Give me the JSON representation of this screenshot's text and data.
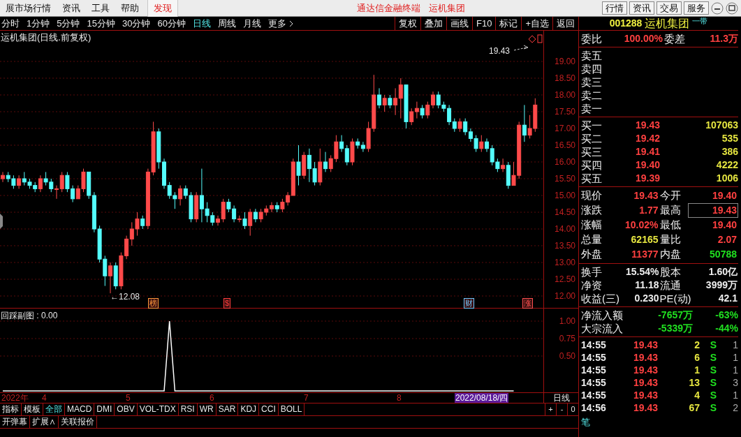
{
  "menu": [
    {
      "label": "展市场行情",
      "selected": false
    },
    {
      "label": "资讯",
      "selected": false
    },
    {
      "label": "工具",
      "selected": false
    },
    {
      "label": "帮助",
      "selected": false
    },
    {
      "label": "发现",
      "selected": true
    }
  ],
  "app_title": [
    "通达信金融终端",
    "运机集团"
  ],
  "top_buttons": [
    "行情",
    "资讯",
    "交易",
    "服务"
  ],
  "periods": [
    {
      "label": "分时",
      "selected": false
    },
    {
      "label": "1分钟",
      "selected": false
    },
    {
      "label": "5分钟",
      "selected": false
    },
    {
      "label": "15分钟",
      "selected": false
    },
    {
      "label": "30分钟",
      "selected": false
    },
    {
      "label": "60分钟",
      "selected": false
    },
    {
      "label": "日线",
      "selected": true
    },
    {
      "label": "周线",
      "selected": false
    },
    {
      "label": "月线",
      "selected": false
    },
    {
      "label": "更多",
      "selected": false
    }
  ],
  "chart_tools": [
    "复权",
    "叠加",
    "画线",
    "F10",
    "标记",
    "+自选",
    "返回"
  ],
  "chart_title": "运机集团(日线.前复权)",
  "chart_data": {
    "type": "candlestick",
    "grid": true,
    "ylim": [
      11.625,
      19.917
    ],
    "yticks": [
      {
        "value": 19,
        "label": "19.00"
      },
      {
        "value": 18.5,
        "label": "18.50"
      },
      {
        "value": 18,
        "label": "18.00"
      },
      {
        "value": 17.5,
        "label": "17.50"
      },
      {
        "value": 17,
        "label": "17.00"
      },
      {
        "value": 16.5,
        "label": "16.50"
      },
      {
        "value": 16,
        "label": "16.00"
      },
      {
        "value": 15.5,
        "label": "15.50"
      },
      {
        "value": 15,
        "label": "15.00"
      },
      {
        "value": 14.5,
        "label": "14.50"
      },
      {
        "value": 14,
        "label": "14.00"
      },
      {
        "value": 13.5,
        "label": "13.50"
      },
      {
        "value": 13,
        "label": "13.00"
      },
      {
        "value": 12.5,
        "label": "12.50"
      },
      {
        "value": 12,
        "label": "12.00"
      }
    ],
    "categories": [
      null,
      null,
      null,
      null,
      null,
      null,
      null,
      null,
      null,
      null,
      null,
      null,
      null,
      null,
      null,
      null,
      null,
      null,
      null,
      null,
      null,
      null,
      null,
      null,
      null,
      null,
      null,
      null,
      null,
      null,
      null,
      null,
      null,
      null,
      null,
      null,
      null,
      null,
      null,
      null,
      null,
      null,
      null,
      null,
      null,
      null,
      null,
      null,
      null,
      null,
      null,
      null,
      null,
      null,
      null,
      null,
      null,
      null,
      null,
      null,
      null,
      null,
      null,
      null,
      null,
      null,
      null,
      null,
      null,
      null,
      null,
      null,
      null,
      null,
      null,
      null,
      null,
      null,
      null,
      null,
      null,
      null,
      null,
      null,
      null,
      null,
      null,
      null,
      null,
      null,
      null,
      null,
      null,
      null,
      null,
      null,
      null,
      null,
      null,
      null
    ],
    "ohlc": [
      [
        15.5,
        15.7,
        15.4,
        15.6
      ],
      [
        15.6,
        15.7,
        15.4,
        15.5
      ],
      [
        15.5,
        15.6,
        15.2,
        15.3
      ],
      [
        15.3,
        15.6,
        15.2,
        15.5
      ],
      [
        15.5,
        15.7,
        15.3,
        15.4
      ],
      [
        15.4,
        15.5,
        15.2,
        15.3
      ],
      [
        15.3,
        15.4,
        15.1,
        15.2
      ],
      [
        15.2,
        15.6,
        15.1,
        15.5
      ],
      [
        15.5,
        15.7,
        15.3,
        15.4
      ],
      [
        15.4,
        15.5,
        15.1,
        15.2
      ],
      [
        15.2,
        15.3,
        14.9,
        15.2
      ],
      [
        15.2,
        15.7,
        15.1,
        15.6
      ],
      [
        15.6,
        15.7,
        15.1,
        15.2
      ],
      [
        15.2,
        15.3,
        14.8,
        14.9
      ],
      [
        14.9,
        15.3,
        14.9,
        15.2
      ],
      [
        15.2,
        15.8,
        15.1,
        15.7
      ],
      [
        15.7,
        15.7,
        14.9,
        15.0
      ],
      [
        15.0,
        15.1,
        13.9,
        14.0
      ],
      [
        14.0,
        14.1,
        13.0,
        13.1
      ],
      [
        13.1,
        13.2,
        12.3,
        12.6
      ],
      [
        12.6,
        13.0,
        12.08,
        12.9
      ],
      [
        12.9,
        13.0,
        12.2,
        12.3
      ],
      [
        12.3,
        13.3,
        12.2,
        13.2
      ],
      [
        13.2,
        13.8,
        13.1,
        13.7
      ],
      [
        13.7,
        14.2,
        13.5,
        14.0
      ],
      [
        14.0,
        14.5,
        13.8,
        14.3
      ],
      [
        14.3,
        14.4,
        14.0,
        14.1
      ],
      [
        14.1,
        15.8,
        14.0,
        15.7
      ],
      [
        15.7,
        17.2,
        15.6,
        16.9
      ],
      [
        16.9,
        17.0,
        15.8,
        16.0
      ],
      [
        16.0,
        16.1,
        15.2,
        15.3
      ],
      [
        15.3,
        15.4,
        14.9,
        15.0
      ],
      [
        15.0,
        15.1,
        14.6,
        14.9
      ],
      [
        14.9,
        15.3,
        14.7,
        15.2
      ],
      [
        15.2,
        15.3,
        14.9,
        15.0
      ],
      [
        15.0,
        15.1,
        14.2,
        14.3
      ],
      [
        14.3,
        15.1,
        14.2,
        15.0
      ],
      [
        15.0,
        15.8,
        14.2,
        14.6
      ],
      [
        14.6,
        14.8,
        14.2,
        14.4
      ],
      [
        14.4,
        14.5,
        14.1,
        14.2
      ],
      [
        14.2,
        14.4,
        14.1,
        14.3
      ],
      [
        14.3,
        14.9,
        14.2,
        14.8
      ],
      [
        14.8,
        14.9,
        14.5,
        14.6
      ],
      [
        14.6,
        14.7,
        14.2,
        14.3
      ],
      [
        14.3,
        14.4,
        14.2,
        14.3
      ],
      [
        14.3,
        14.5,
        14.0,
        14.1
      ],
      [
        14.1,
        14.6,
        13.8,
        14.5
      ],
      [
        14.5,
        14.6,
        14.2,
        14.3
      ],
      [
        14.3,
        14.6,
        14.2,
        14.5
      ],
      [
        14.5,
        14.7,
        14.4,
        14.6
      ],
      [
        14.6,
        14.8,
        14.5,
        14.7
      ],
      [
        14.7,
        14.8,
        14.5,
        14.6
      ],
      [
        14.6,
        14.9,
        14.5,
        14.8
      ],
      [
        14.8,
        15.1,
        14.7,
        15.0
      ],
      [
        15.0,
        16.1,
        15.0,
        16.0
      ],
      [
        16.0,
        16.5,
        15.3,
        15.6
      ],
      [
        15.6,
        16.3,
        15.5,
        16.2
      ],
      [
        16.2,
        16.4,
        15.4,
        15.8
      ],
      [
        15.8,
        16.0,
        15.3,
        15.4
      ],
      [
        15.4,
        16.4,
        15.3,
        16.0
      ],
      [
        16.0,
        16.3,
        15.7,
        15.8
      ],
      [
        15.8,
        16.2,
        15.7,
        16.1
      ],
      [
        16.1,
        16.8,
        16.0,
        16.6
      ],
      [
        16.6,
        16.8,
        16.3,
        16.4
      ],
      [
        16.4,
        16.5,
        15.9,
        16.0
      ],
      [
        16.0,
        16.7,
        15.9,
        16.6
      ],
      [
        16.6,
        16.7,
        16.4,
        16.5
      ],
      [
        16.5,
        16.6,
        16.3,
        16.4
      ],
      [
        16.4,
        17.2,
        16.3,
        17.0
      ],
      [
        17.0,
        18.6,
        16.9,
        18.0
      ],
      [
        18.0,
        18.2,
        17.6,
        17.7
      ],
      [
        17.7,
        18.0,
        17.5,
        17.9
      ],
      [
        17.9,
        18.0,
        17.6,
        17.7
      ],
      [
        17.7,
        18.2,
        17.4,
        17.9
      ],
      [
        17.9,
        18.5,
        17.3,
        18.3
      ],
      [
        18.3,
        18.3,
        17.0,
        17.2
      ],
      [
        17.2,
        17.6,
        17.1,
        17.5
      ],
      [
        17.5,
        17.8,
        17.3,
        17.6
      ],
      [
        17.6,
        17.7,
        17.3,
        17.4
      ],
      [
        17.4,
        17.8,
        17.3,
        17.7
      ],
      [
        17.7,
        18.1,
        17.6,
        18.0
      ],
      [
        18.0,
        18.1,
        17.6,
        17.7
      ],
      [
        17.7,
        17.8,
        17.5,
        17.6
      ],
      [
        17.6,
        17.7,
        17.1,
        17.2
      ],
      [
        17.2,
        17.3,
        16.9,
        17.0
      ],
      [
        17.0,
        17.3,
        16.9,
        17.2
      ],
      [
        17.2,
        17.3,
        16.8,
        16.9
      ],
      [
        16.9,
        17.0,
        16.6,
        16.7
      ],
      [
        16.7,
        16.8,
        16.3,
        16.4
      ],
      [
        16.4,
        16.8,
        16.3,
        16.6
      ],
      [
        16.6,
        16.7,
        16.3,
        16.4
      ],
      [
        16.4,
        16.5,
        15.9,
        16.0
      ],
      [
        16.0,
        16.1,
        15.7,
        15.8
      ],
      [
        15.8,
        16.1,
        15.7,
        15.9
      ],
      [
        15.9,
        16.0,
        15.2,
        15.3
      ],
      [
        15.3,
        16.0,
        15.3,
        15.6
      ],
      [
        15.6,
        17.2,
        15.5,
        17.1
      ],
      [
        17.1,
        17.7,
        16.6,
        16.8
      ],
      [
        16.8,
        17.4,
        16.7,
        17.0
      ],
      [
        17.0,
        17.9,
        16.9,
        17.7
      ]
    ]
  },
  "last_price_label": "19.43",
  "low_label": "←12.08",
  "event_markers": [
    {
      "label": "榜",
      "color": "#ff9a3c"
    },
    {
      "label": "$",
      "color": "#ff3c3c"
    },
    {
      "label": "财",
      "color": "#6ec8ff"
    },
    {
      "label": "涨",
      "color": "#ff5050"
    }
  ],
  "subchart": {
    "title": "回踩副图 : 0.00",
    "chart_data": {
      "type": "line",
      "grid": true,
      "ylim": [
        -0.17,
        1
      ],
      "yticks": [
        {
          "value": 1,
          "label": "1.00"
        },
        {
          "value": 0.75,
          "label": "0.75"
        },
        {
          "value": 0.5,
          "label": "0.50"
        }
      ],
      "categories": [
        null,
        null,
        null,
        null,
        null,
        null,
        null,
        null,
        null,
        null,
        null,
        null,
        null,
        null,
        null,
        null,
        null,
        null,
        null,
        null,
        null,
        null,
        null,
        null,
        null,
        null,
        null,
        null,
        null,
        null,
        null,
        null,
        null,
        null,
        null,
        null,
        null,
        null,
        null,
        null,
        null,
        null,
        null,
        null,
        null,
        null,
        null,
        null,
        null,
        null,
        null,
        null,
        null,
        null,
        null,
        null,
        null,
        null,
        null,
        null,
        null,
        null,
        null,
        null,
        null,
        null,
        null,
        null,
        null,
        null,
        null,
        null,
        null,
        null,
        null,
        null,
        null,
        null,
        null,
        null,
        null,
        null,
        null,
        null,
        null,
        null,
        null,
        null,
        null,
        null,
        null,
        null,
        null,
        null,
        null,
        null
      ],
      "series": [
        {
          "color": "#ffffff",
          "values": [
            0,
            0,
            0,
            0,
            0,
            0,
            0,
            0,
            0,
            0,
            0,
            0,
            0,
            0,
            0,
            0,
            0,
            0,
            0,
            0,
            0,
            0,
            0,
            0,
            0,
            0,
            0,
            0,
            0,
            0,
            0,
            1,
            0,
            0,
            0,
            0,
            0,
            0,
            0,
            0,
            0,
            0,
            0,
            0,
            0,
            0,
            0,
            0,
            0,
            0,
            0,
            0,
            0,
            0,
            0,
            0,
            0,
            0,
            0,
            0,
            0,
            0,
            0,
            0,
            0,
            0,
            0,
            0,
            0,
            0,
            0,
            0,
            0,
            0,
            0,
            0,
            0,
            0,
            0,
            0,
            0,
            0,
            0,
            0,
            0,
            0,
            0,
            0,
            0,
            0,
            0,
            0,
            0,
            0,
            0,
            0
          ]
        }
      ]
    }
  },
  "date_axis": [
    "2022年",
    "4",
    "5",
    "6",
    "7",
    "8"
  ],
  "cursor_date": "2022/08/18/四",
  "period_label": "日线",
  "indicator_tabs": [
    {
      "label": "指标",
      "selected": false
    },
    {
      "label": "模板",
      "selected": false
    },
    {
      "label": "全部",
      "selected": true
    },
    {
      "label": "MACD",
      "selected": false
    },
    {
      "label": "DMI",
      "selected": false
    },
    {
      "label": "OBV",
      "selected": false
    },
    {
      "label": "VOL-TDX",
      "selected": false
    },
    {
      "label": "RSI",
      "selected": false
    },
    {
      "label": "WR",
      "selected": false
    },
    {
      "label": "SAR",
      "selected": false
    },
    {
      "label": "KDJ",
      "selected": false
    },
    {
      "label": "CCI",
      "selected": false
    },
    {
      "label": "BOLL",
      "selected": false
    }
  ],
  "zoom_buttons": [
    "+",
    "-",
    "0"
  ],
  "bottom_tabs": [
    "开弹幕",
    "扩展∧",
    "关联报价"
  ],
  "quote": {
    "code": "001288",
    "name": "运机集团",
    "tag": "一带",
    "weibi": {
      "label": "委比",
      "value": "100.00%",
      "label2": "委差",
      "value2": "11.3万"
    },
    "sell": [
      "卖五",
      "卖四",
      "卖三",
      "卖二",
      "卖一"
    ],
    "buy": [
      {
        "label": "买一",
        "price": "19.43",
        "volume": "107063"
      },
      {
        "label": "买二",
        "price": "19.42",
        "volume": "535"
      },
      {
        "label": "买三",
        "price": "19.41",
        "volume": "386"
      },
      {
        "label": "买四",
        "price": "19.40",
        "volume": "4222"
      },
      {
        "label": "买五",
        "price": "19.39",
        "volume": "1006"
      }
    ],
    "stats": [
      [
        {
          "label": "现价",
          "value": "19.43",
          "color": "#ff4040",
          "highlighted": false
        },
        {
          "label": "今开",
          "value": "19.40",
          "color": "#ff4040",
          "highlighted": false
        }
      ],
      [
        {
          "label": "涨跌",
          "value": "1.77",
          "color": "#ff4040",
          "highlighted": false
        },
        {
          "label": "最高",
          "value": "19.43",
          "color": "#ff4040",
          "highlighted": true
        }
      ],
      [
        {
          "label": "涨幅",
          "value": "10.02%",
          "color": "#ff4040",
          "highlighted": false
        },
        {
          "label": "最低",
          "value": "19.40",
          "color": "#ff4040",
          "highlighted": false
        }
      ],
      [
        {
          "label": "总量",
          "value": "62165",
          "color": "#e6e640",
          "highlighted": false
        },
        {
          "label": "量比",
          "value": "2.07",
          "color": "#ff4040",
          "highlighted": false
        }
      ],
      [
        {
          "label": "外盘",
          "value": "11377",
          "color": "#ff4040",
          "highlighted": false
        },
        {
          "label": "内盘",
          "value": "50788",
          "color": "#20e020",
          "highlighted": false
        }
      ]
    ],
    "finance": [
      [
        {
          "label": "换手",
          "value": "15.54%"
        },
        {
          "label": "股本",
          "value": "1.60亿"
        }
      ],
      [
        {
          "label": "净资",
          "value": "11.18"
        },
        {
          "label": "流通",
          "value": "3999万"
        }
      ],
      [
        {
          "label": "收益(三)",
          "value": "0.230"
        },
        {
          "label": "PE(动)",
          "value": "42.1"
        }
      ]
    ],
    "flows": [
      {
        "label": "净流入额",
        "amount": "-7657万",
        "ratio": "-63%"
      },
      {
        "label": "大宗流入",
        "amount": "-5339万",
        "ratio": "-44%"
      }
    ],
    "ticks": [
      {
        "time": "14:55",
        "price": "19.43",
        "volume": "2",
        "side": "S",
        "count": "1"
      },
      {
        "time": "14:55",
        "price": "19.43",
        "volume": "6",
        "side": "S",
        "count": "1"
      },
      {
        "time": "14:55",
        "price": "19.43",
        "volume": "1",
        "side": "S",
        "count": "1"
      },
      {
        "time": "14:55",
        "price": "19.43",
        "volume": "13",
        "side": "S",
        "count": "3"
      },
      {
        "time": "14:55",
        "price": "19.43",
        "volume": "4",
        "side": "S",
        "count": "1"
      },
      {
        "time": "14:56",
        "price": "19.43",
        "volume": "67",
        "side": "S",
        "count": "2"
      }
    ],
    "bottom_tab": "笔"
  }
}
